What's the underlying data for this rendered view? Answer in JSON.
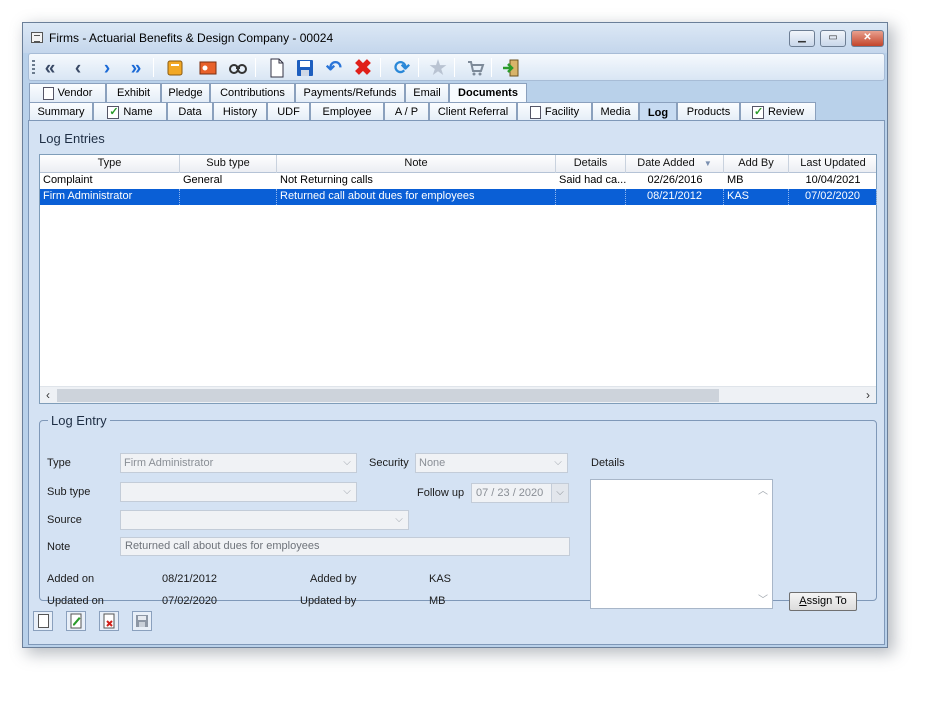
{
  "window": {
    "title": "Firms - Actuarial Benefits & Design Company - 00024",
    "controls": [
      "minimize",
      "maximize",
      "close"
    ]
  },
  "toolbar": {
    "icons": [
      "first-icon",
      "previous-icon",
      "next-icon",
      "last-icon",
      "book-icon",
      "card-icon",
      "binoculars-icon",
      "new-page-icon",
      "save-icon",
      "undo-icon",
      "delete-icon",
      "refresh-icon",
      "star-icon",
      "cart-icon",
      "exit-icon"
    ]
  },
  "tabs_row1": [
    "Vendor",
    "Exhibit",
    "Pledge",
    "Contributions",
    "Payments/Refunds",
    "Email",
    "Documents"
  ],
  "tabs_row2": [
    "Summary",
    "Name",
    "Data",
    "History",
    "UDF",
    "Employee",
    "A / P",
    "Client Referral",
    "Facility",
    "Media",
    "Log",
    "Products",
    "Review"
  ],
  "log_entries": {
    "title": "Log Entries",
    "columns": [
      "Type",
      "Sub type",
      "Note",
      "Details",
      "Date Added",
      "Add By",
      "Last Updated"
    ],
    "sort_indicator": "▼",
    "rows": [
      {
        "type": "Complaint",
        "subtype": "General",
        "note": "Not Returning calls",
        "details": "Said had ca...",
        "date_added": "02/26/2016",
        "add_by": "MB",
        "last_updated": "10/04/2021"
      },
      {
        "type": "Firm Administrator",
        "subtype": "",
        "note": "Returned call about dues for employees",
        "details": "",
        "date_added": "08/21/2012",
        "add_by": "KAS",
        "last_updated": "07/02/2020"
      }
    ],
    "selected_row": 1
  },
  "log_entry": {
    "legend": "Log Entry",
    "type_label": "Type",
    "type_value": "Firm Administrator",
    "security_label": "Security",
    "security_value": "None",
    "subtype_label": "Sub type",
    "subtype_value": "",
    "followup_label": "Follow up",
    "followup_value": "07 / 23 / 2020",
    "source_label": "Source",
    "source_value": "",
    "note_label": "Note",
    "note_value": "Returned call about dues for employees",
    "details_label": "Details",
    "added_on_label": "Added on",
    "added_on_value": "08/21/2012",
    "added_by_label": "Added by",
    "added_by_value": "KAS",
    "updated_on_label": "Updated on",
    "updated_on_value": "07/02/2020",
    "updated_by_label": "Updated by",
    "updated_by_value": "MB",
    "assign_to_label": "ssign To",
    "assign_to_accesskey": "A"
  },
  "bottom_actions": [
    "new-icon",
    "edit-icon",
    "delete-icon",
    "save-icon"
  ]
}
